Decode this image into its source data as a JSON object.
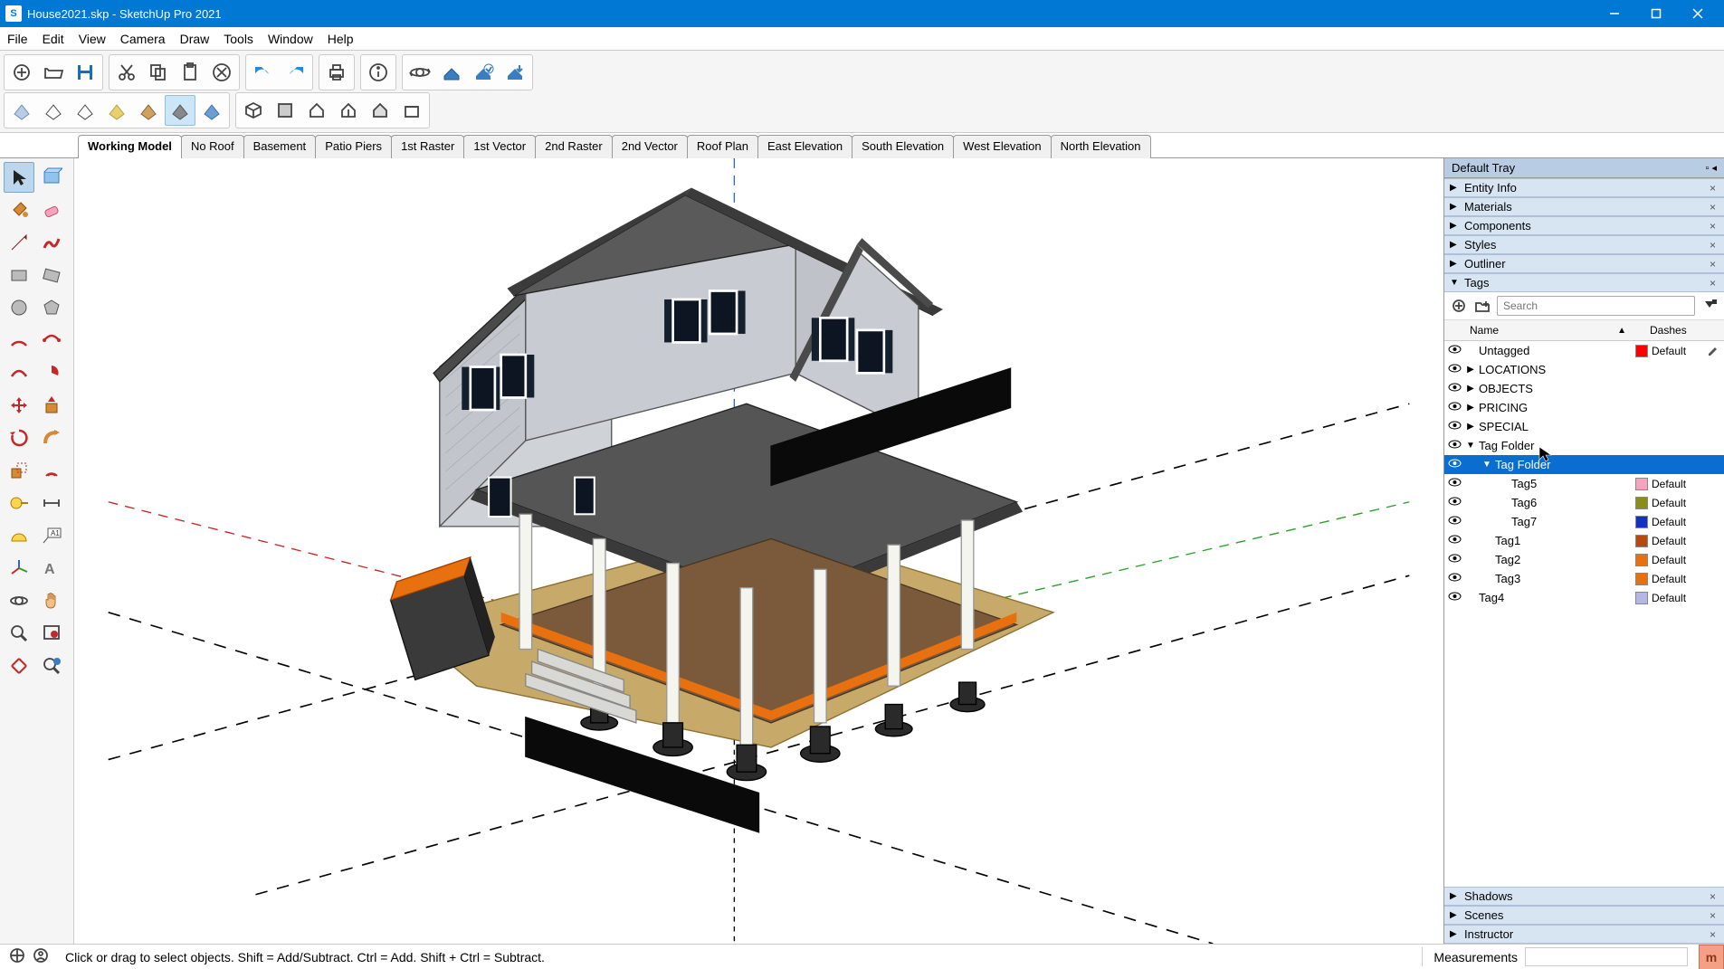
{
  "titlebar": {
    "filename": "House2021.skp",
    "appname": "SketchUp Pro 2021"
  },
  "menu": [
    "File",
    "Edit",
    "View",
    "Camera",
    "Draw",
    "Tools",
    "Window",
    "Help"
  ],
  "scenes": [
    "Working Model",
    "No Roof",
    "Basement",
    "Patio Piers",
    "1st Raster",
    "1st Vector",
    "2nd Raster",
    "2nd Vector",
    "Roof Plan",
    "East Elevation",
    "South Elevation",
    "West Elevation",
    "North Elevation"
  ],
  "active_scene_index": 0,
  "tray": {
    "title": "Default Tray",
    "panels": [
      "Entity Info",
      "Materials",
      "Components",
      "Styles",
      "Outliner"
    ],
    "tags_panel_title": "Tags",
    "bottom_panels": [
      "Shadows",
      "Scenes",
      "Instructor"
    ],
    "search_placeholder": "Search",
    "headers": {
      "name": "Name",
      "dashes": "Dashes"
    },
    "tags": [
      {
        "vis": true,
        "expand": "",
        "indent": 0,
        "name": "Untagged",
        "swatch": "#ff0000",
        "dash": "Default",
        "edit": true
      },
      {
        "vis": true,
        "expand": "▶",
        "indent": 0,
        "name": "LOCATIONS",
        "swatch": "",
        "dash": ""
      },
      {
        "vis": true,
        "expand": "▶",
        "indent": 0,
        "name": "OBJECTS",
        "swatch": "",
        "dash": ""
      },
      {
        "vis": true,
        "expand": "▶",
        "indent": 0,
        "name": "PRICING",
        "swatch": "",
        "dash": ""
      },
      {
        "vis": true,
        "expand": "▶",
        "indent": 0,
        "name": "SPECIAL",
        "swatch": "",
        "dash": ""
      },
      {
        "vis": true,
        "expand": "▼",
        "indent": 0,
        "name": "Tag Folder",
        "swatch": "",
        "dash": ""
      },
      {
        "vis": true,
        "expand": "▼",
        "indent": 1,
        "name": "Tag Folder",
        "swatch": "",
        "dash": "",
        "selected": true
      },
      {
        "vis": true,
        "expand": "",
        "indent": 2,
        "name": "Tag5",
        "swatch": "#f5a3bf",
        "dash": "Default"
      },
      {
        "vis": true,
        "expand": "",
        "indent": 2,
        "name": "Tag6",
        "swatch": "#8a8d1a",
        "dash": "Default"
      },
      {
        "vis": true,
        "expand": "",
        "indent": 2,
        "name": "Tag7",
        "swatch": "#1232c6",
        "dash": "Default"
      },
      {
        "vis": true,
        "expand": "",
        "indent": 1,
        "name": "Tag1",
        "swatch": "#b44a0e",
        "dash": "Default"
      },
      {
        "vis": true,
        "expand": "",
        "indent": 1,
        "name": "Tag2",
        "swatch": "#e8700f",
        "dash": "Default"
      },
      {
        "vis": true,
        "expand": "",
        "indent": 1,
        "name": "Tag3",
        "swatch": "#e8700f",
        "dash": "Default"
      },
      {
        "vis": true,
        "expand": "",
        "indent": 0,
        "name": "Tag4",
        "swatch": "#b6b6e6",
        "dash": "Default"
      }
    ]
  },
  "statusbar": {
    "hint": "Click or drag to select objects. Shift = Add/Subtract. Ctrl = Add. Shift + Ctrl = Subtract.",
    "measurements_label": "Measurements"
  }
}
